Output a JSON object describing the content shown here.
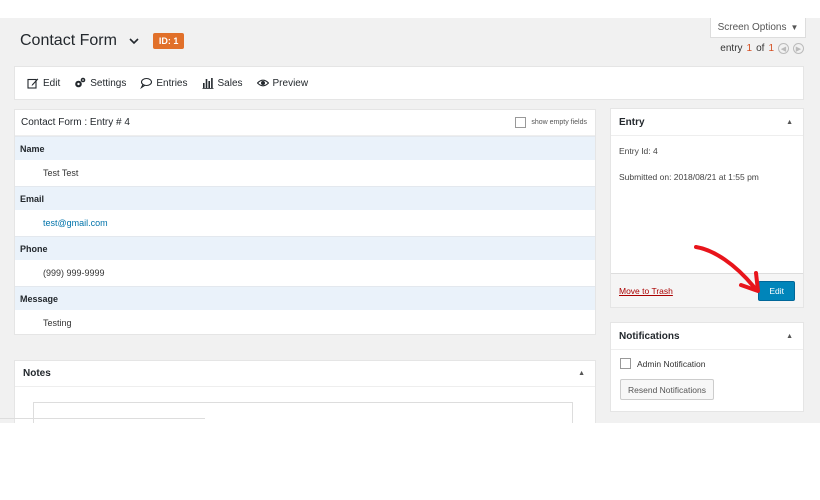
{
  "header": {
    "title": "Contact Form",
    "id_badge": "ID: 1",
    "screen_options": "Screen Options",
    "pager": {
      "prefix": "entry",
      "current": "1",
      "of": "of",
      "total": "1"
    }
  },
  "toolbar": {
    "items": [
      {
        "label": "Edit",
        "icon": "edit-icon"
      },
      {
        "label": "Settings",
        "icon": "gears-icon"
      },
      {
        "label": "Entries",
        "icon": "speech-bubble-icon"
      },
      {
        "label": "Sales",
        "icon": "bar-chart-icon"
      },
      {
        "label": "Preview",
        "icon": "eye-icon"
      }
    ]
  },
  "entry_panel": {
    "heading": "Contact Form : Entry # 4",
    "show_empty_label": "show empty fields",
    "fields": [
      {
        "label": "Name",
        "value": "Test Test"
      },
      {
        "label": "Email",
        "value": "test@gmail.com"
      },
      {
        "label": "Phone",
        "value": "(999) 999-9999"
      },
      {
        "label": "Message",
        "value": "Testing"
      }
    ]
  },
  "notes": {
    "title": "Notes"
  },
  "entry_box": {
    "title": "Entry",
    "entry_id": "Entry Id: 4",
    "submitted": "Submitted on: 2018/08/21 at 1:55 pm",
    "trash_label": "Move to Trash",
    "edit_label": "Edit"
  },
  "notifications": {
    "title": "Notifications",
    "admin_label": "Admin Notification",
    "resend_label": "Resend Notifications"
  },
  "colors": {
    "accent_button": "#0085ba",
    "badge": "#e1702a",
    "annotation_arrow": "#e8141b",
    "field_label_bg": "#eaf2fa"
  }
}
